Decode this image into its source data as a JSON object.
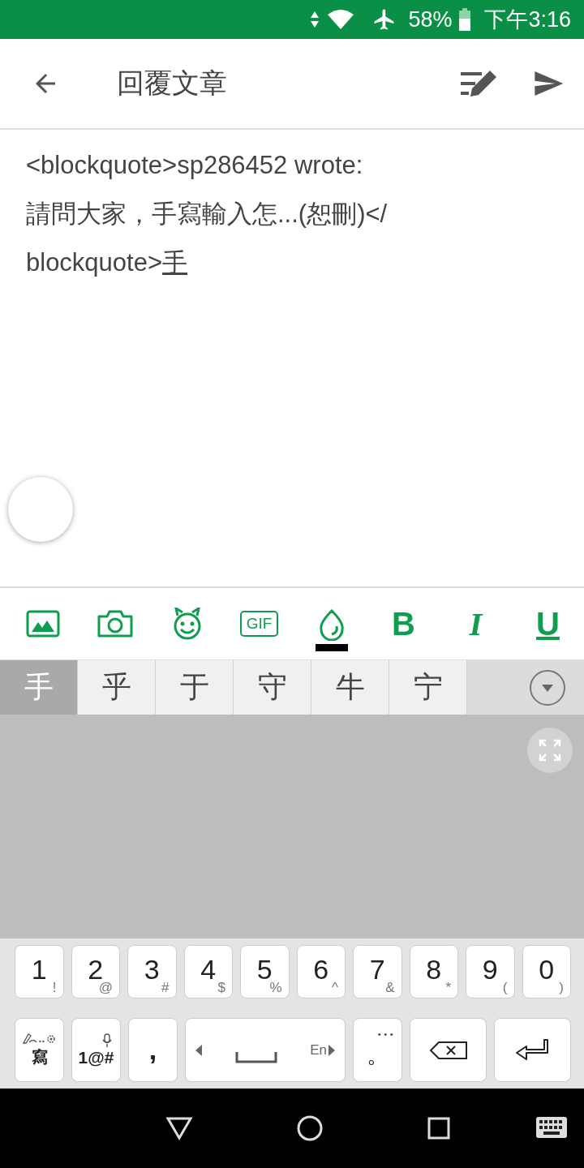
{
  "status_bar": {
    "battery": "58%",
    "time": "下午3:16"
  },
  "header": {
    "title": "回覆文章"
  },
  "body": {
    "lines": [
      "<blockquote>sp286452 wrote:",
      "請問大家，手寫輸入怎...(恕刪)</",
      "blockquote>"
    ],
    "composing": "手"
  },
  "toolbar": [
    {
      "kind": "image"
    },
    {
      "kind": "camera"
    },
    {
      "kind": "emoji"
    },
    {
      "kind": "gif",
      "label": "GIF"
    },
    {
      "kind": "color",
      "color": "#000000"
    },
    {
      "kind": "bold",
      "label": "B"
    },
    {
      "kind": "italic",
      "label": "I"
    },
    {
      "kind": "underline",
      "label": "U"
    }
  ],
  "candidates": [
    {
      "text": "手",
      "selected": true
    },
    {
      "text": "乎",
      "selected": false
    },
    {
      "text": "于",
      "selected": false
    },
    {
      "text": "守",
      "selected": false
    },
    {
      "text": "牛",
      "selected": false
    },
    {
      "text": "宁",
      "selected": false
    }
  ],
  "number_keys": [
    {
      "main": "1",
      "sub": "!"
    },
    {
      "main": "2",
      "sub": "@"
    },
    {
      "main": "3",
      "sub": "#"
    },
    {
      "main": "4",
      "sub": "$"
    },
    {
      "main": "5",
      "sub": "%"
    },
    {
      "main": "6",
      "sub": "^"
    },
    {
      "main": "7",
      "sub": "&"
    },
    {
      "main": "8",
      "sub": "*"
    },
    {
      "main": "9",
      "sub": "("
    },
    {
      "main": "0",
      "sub": ")"
    }
  ],
  "bottom_keys": [
    {
      "kind": "write",
      "label": "寫",
      "hint": ".."
    },
    {
      "kind": "symbols",
      "label": "1@#"
    },
    {
      "kind": "comma",
      "label": ","
    },
    {
      "kind": "space",
      "hint": "En"
    },
    {
      "kind": "period",
      "label": "。",
      "hint": "•••"
    },
    {
      "kind": "backspace"
    },
    {
      "kind": "enter"
    }
  ]
}
